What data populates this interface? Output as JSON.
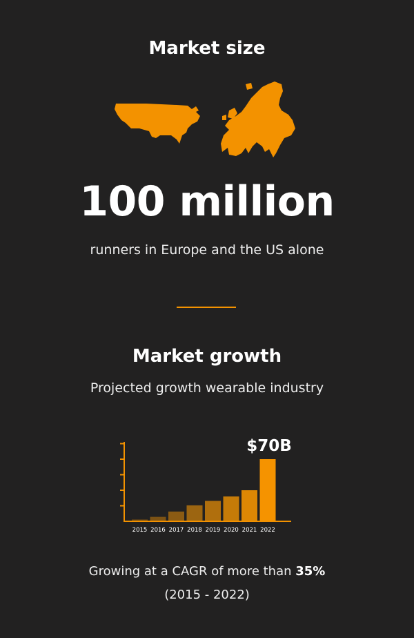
{
  "section1": {
    "title": "Market size",
    "big_number": "100 million",
    "subtitle": "runners in Europe and the US alone"
  },
  "section2": {
    "title": "Market growth",
    "subtitle": "Projected growth wearable industry"
  },
  "footer": {
    "line1_prefix": "Growing at a CAGR of more than ",
    "line1_highlight": "35%",
    "line2": "(2015 - 2022)"
  },
  "icons": {
    "us_map": "us-map-icon",
    "europe_map": "europe-map-icon"
  },
  "colors": {
    "background": "#222121",
    "accent": "#f39200",
    "text": "#ffffff"
  },
  "chart_data": {
    "type": "bar",
    "categories": [
      "2015",
      "2016",
      "2017",
      "2018",
      "2019",
      "2020",
      "2021",
      "2022"
    ],
    "values": [
      2,
      5,
      11,
      18,
      23,
      28,
      35,
      70
    ],
    "annotation": "$70B",
    "bar_colors": [
      "#6e4a14",
      "#7c5214",
      "#8b5b13",
      "#9c6511",
      "#b06f0d",
      "#c57b08",
      "#dc8704",
      "#f59300"
    ]
  }
}
